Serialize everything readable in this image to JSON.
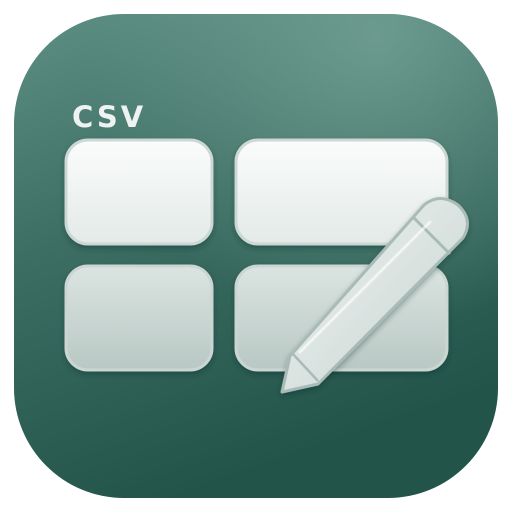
{
  "app_icon": {
    "label": "CSV",
    "grid": {
      "rows": 2,
      "cols": 2
    },
    "colors": {
      "background_light": "#5b8c80",
      "background_mid": "#3c6d62",
      "background_dark": "#24564b",
      "cell_light": "#f4f7f6",
      "cell_dark": "#c9d4d1",
      "cell_border": "#d8e2df",
      "pencil_body": "#e3ebe8",
      "pencil_edge": "#b7c7c3",
      "label": "#eef3f1"
    },
    "icons": [
      "table-grid-icon",
      "pencil-icon"
    ]
  }
}
